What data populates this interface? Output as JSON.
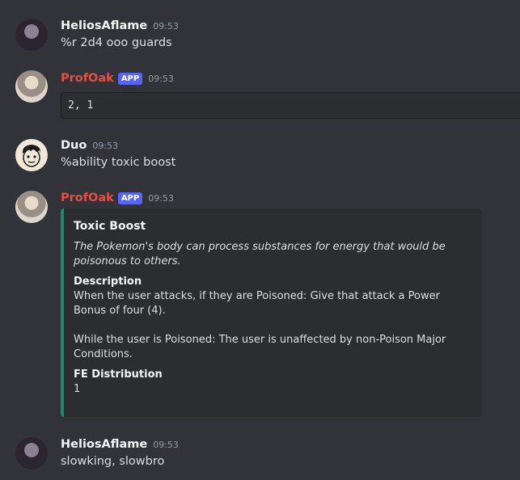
{
  "messages": [
    {
      "username": "HeliosAflame",
      "time": "09:53",
      "text": "%r 2d4 ooo guards"
    },
    {
      "username": "ProfOak",
      "badge": "APP",
      "time": "09:53",
      "code": "2, 1"
    },
    {
      "username": "Duo",
      "time": "09:53",
      "text": "%ability toxic boost"
    },
    {
      "username": "ProfOak",
      "badge": "APP",
      "time": "09:53",
      "embed": {
        "title": "Toxic Boost",
        "description": "The Pokemon's body can process substances for energy that would be poisonous to others.",
        "fields": [
          {
            "name": "Description",
            "value": "When the user attacks, if they are Poisoned: Give that attack a Power Bonus of four (4).\n\nWhile the user is Poisoned: The user is unaffected by non-Poison Major Conditions."
          },
          {
            "name": "FE Distribution",
            "value": "1"
          }
        ],
        "accent_color": "#1f8b6b"
      }
    },
    {
      "username": "HeliosAflame",
      "time": "09:53",
      "text": "slowking, slowbro"
    }
  ],
  "colors": {
    "background": "#313338",
    "bot_name": "#e0504a",
    "badge": "#5865f2"
  }
}
